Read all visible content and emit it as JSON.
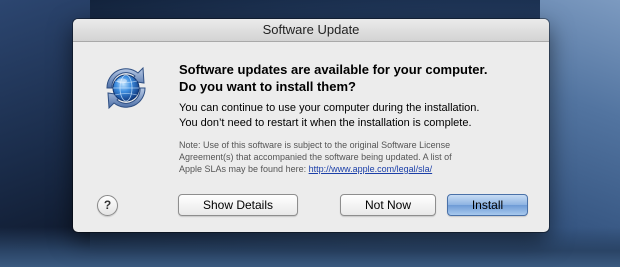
{
  "window": {
    "title": "Software Update"
  },
  "icon": {
    "name": "software-update-icon"
  },
  "heading": {
    "line1": "Software updates are available for your computer.",
    "line2": "Do you want to install them?"
  },
  "body": {
    "line1": "You can continue to use your computer during the installation.",
    "line2": "You don’t need to restart it when the installation is complete."
  },
  "note": {
    "line1": "Note: Use of this software is subject to the original Software License",
    "line2": "Agreement(s) that accompanied the software being updated. A list of",
    "line3_prefix": "Apple SLAs may be found here: ",
    "link": "http://www.apple.com/legal/sla/"
  },
  "buttons": {
    "help": "?",
    "show_details": "Show Details",
    "not_now": "Not Now",
    "install": "Install"
  },
  "colors": {
    "default_button": "#8db3e2",
    "link": "#1b3fa8"
  }
}
